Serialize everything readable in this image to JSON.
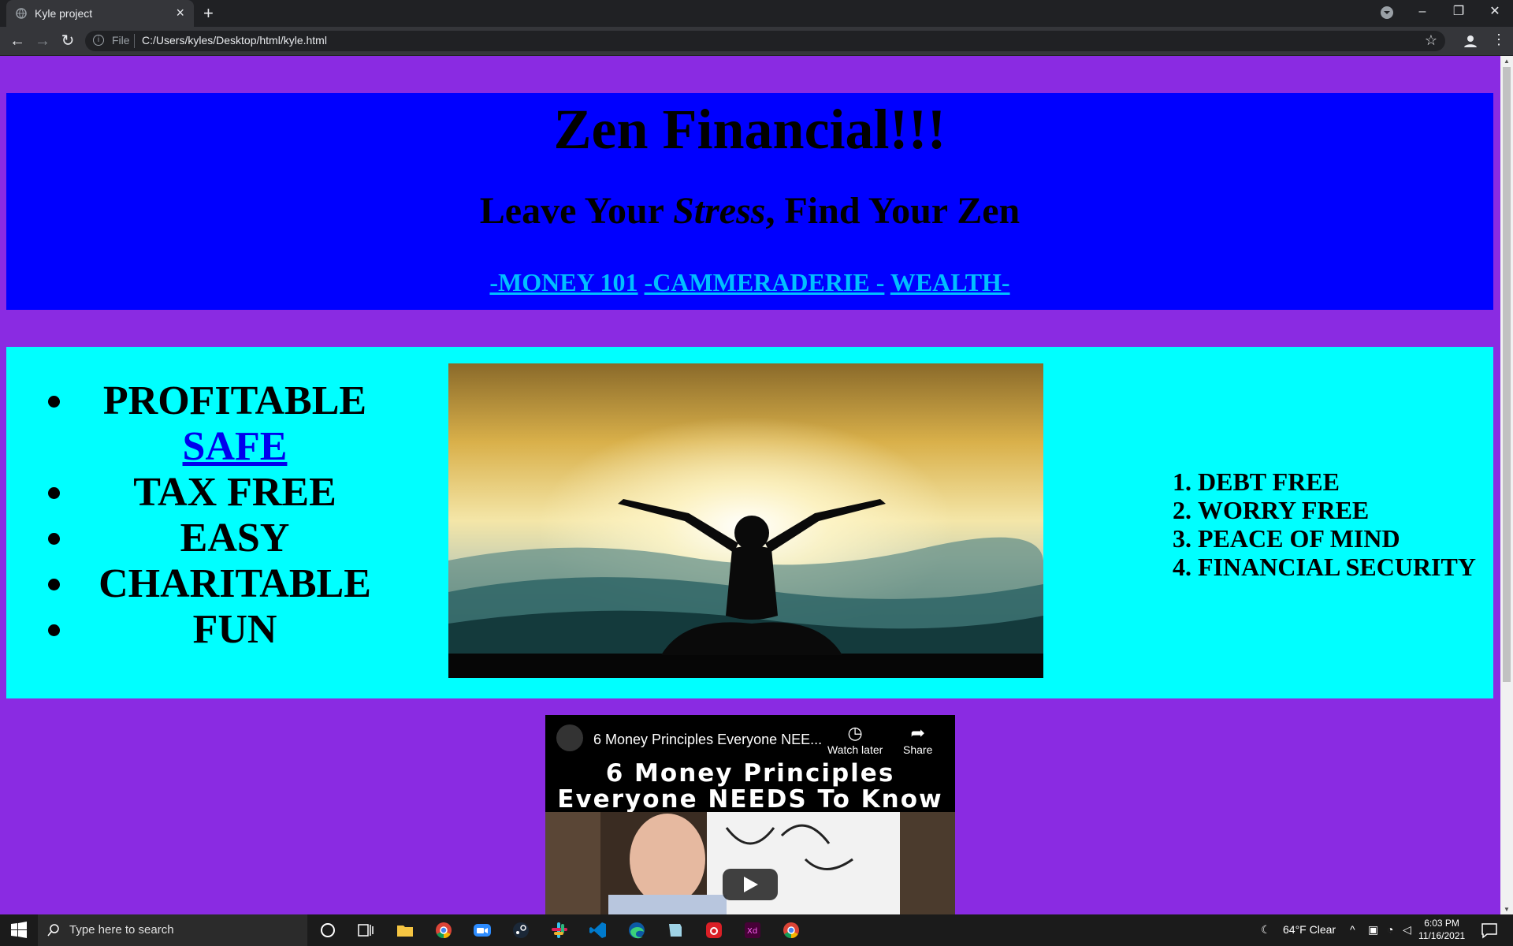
{
  "browser": {
    "tab_title": "Kyle project",
    "address_file_label": "File",
    "address_url": "C:/Users/kyles/Desktop/html/kyle.html"
  },
  "page": {
    "title": "Zen Financial!!!",
    "tagline_before": "Leave Your ",
    "tagline_em": "Stress",
    "tagline_after": ", Find Your Zen",
    "nav_links": [
      "-MONEY 101",
      "-CAMMERADERIE -",
      "WEALTH-"
    ],
    "features": [
      "PROFITABLE",
      "SAFE",
      "TAX FREE",
      "EASY",
      "CHARITABLE",
      "FUN"
    ],
    "benefits": [
      "DEBT FREE",
      "WORRY FREE",
      "PEACE OF MIND",
      "FINANCIAL SECURITY"
    ],
    "video": {
      "title": "6 Money Principles Everyone NEE...",
      "watch_later": "Watch later",
      "share": "Share",
      "banner_line1": "6 Money Principles",
      "banner_line2": "Everyone NEEDS To Know"
    }
  },
  "taskbar": {
    "search_placeholder": "Type here to search",
    "weather": "64°F  Clear",
    "time": "6:03 PM",
    "date": "11/16/2021"
  },
  "colors": {
    "page_bg": "#8a2be2",
    "header_bg": "#0000ff",
    "middle_bg": "#00ffff",
    "link_color": "#00bfff"
  }
}
